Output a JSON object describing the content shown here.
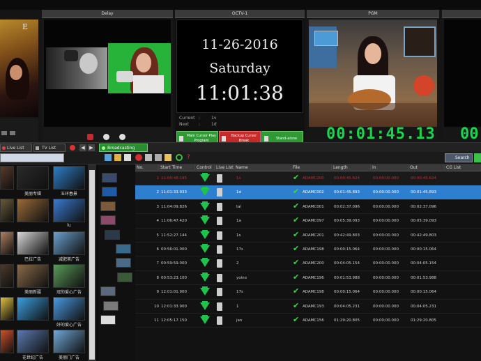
{
  "monitors": {
    "delay_title": "Delay",
    "clock_title": "OCTV-1",
    "pgm_title": "PGM",
    "date": "11-26-2016",
    "weekday": "Saturday",
    "time": "11:01:38",
    "current_label": "Current",
    "current_value": "1v",
    "next_label": "Next",
    "next_value": "1d",
    "left_tag": "E",
    "timecode": "00:01:45.13",
    "right_timecode_partial": "00"
  },
  "onair_buttons": [
    {
      "label": "Main Cursor Play Program",
      "color": "#2f9a35"
    },
    {
      "label": "Backup Cursor Break",
      "color": "#c62a2a"
    },
    {
      "label": "Stand-alone",
      "color": "#2f9a35"
    }
  ],
  "left_tabs": {
    "live_list": "Live List",
    "tv_list": "TV List"
  },
  "status_tab": "Broadcasting",
  "toolbar_right": "Search",
  "table": {
    "headers": [
      "No.",
      "Start Time",
      "Control",
      "Live",
      "List",
      "Name",
      "File",
      "Length",
      "In",
      "Out",
      "CG List"
    ],
    "rows": [
      {
        "no": "1",
        "start": "11:00:48.195",
        "name": "1v",
        "file": "ADAMC200",
        "length": "00:00:45.624",
        "in": "00:00:00.000",
        "out": "00:00:45.624"
      },
      {
        "no": "2",
        "start": "11:01:33.933",
        "name": "1d",
        "file": "ADAMC002",
        "length": "00:01:45.893",
        "in": "00:00:00.000",
        "out": "00:01:45.893"
      },
      {
        "no": "3",
        "start": "11:04:09.826",
        "name": "tal",
        "file": "ADAMC001",
        "length": "00:02:37.096",
        "in": "00:00:00.000",
        "out": "00:02:37.096"
      },
      {
        "no": "4",
        "start": "11:06:47.420",
        "name": "1a",
        "file": "ADAMC097",
        "length": "00:05:39.093",
        "in": "00:00:00.000",
        "out": "00:05:39.093"
      },
      {
        "no": "5",
        "start": "11:52:27.144",
        "name": "1s",
        "file": "ADAMC201",
        "length": "00:42:49.803",
        "in": "00:00:00.000",
        "out": "00:42:49.803"
      },
      {
        "no": "6",
        "start": "00:56:01.000",
        "name": "17s",
        "file": "ADAMC198",
        "length": "00:00:15.064",
        "in": "00:00:00.000",
        "out": "00:00:15.064"
      },
      {
        "no": "7",
        "start": "00:59:59.000",
        "name": "2",
        "file": "ADAMC200",
        "length": "00:04:05.154",
        "in": "00:00:00.000",
        "out": "00:04:05.154"
      },
      {
        "no": "8",
        "start": "00:53:23.100",
        "name": "yoino",
        "file": "ADAMC196",
        "length": "00:01:53.988",
        "in": "00:00:00.000",
        "out": "00:01:53.988"
      },
      {
        "no": "9",
        "start": "12:01:01.900",
        "name": "17s",
        "file": "ADAMC198",
        "length": "00:00:15.064",
        "in": "00:00:00.000",
        "out": "00:00:15.064"
      },
      {
        "no": "10",
        "start": "12:01:33.900",
        "name": "1",
        "file": "ADAMC193",
        "length": "00:04:05.231",
        "in": "00:00:00.000",
        "out": "00:04:05.231"
      },
      {
        "no": "11",
        "start": "12:05:17.150",
        "name": "jan",
        "file": "ADAMC156",
        "length": "01:29:20.805",
        "in": "00:00:00.000",
        "out": "01:29:20.805"
      }
    ]
  },
  "library": {
    "captions": [
      "美丽专辑",
      "玉环春景",
      "",
      "lu",
      "巴拉广告",
      "减肥茶广告",
      "美丽新疆",
      "冠的爱心广告",
      "",
      "好的爱心广告",
      "花世纪广告",
      "美丽门广告"
    ]
  }
}
